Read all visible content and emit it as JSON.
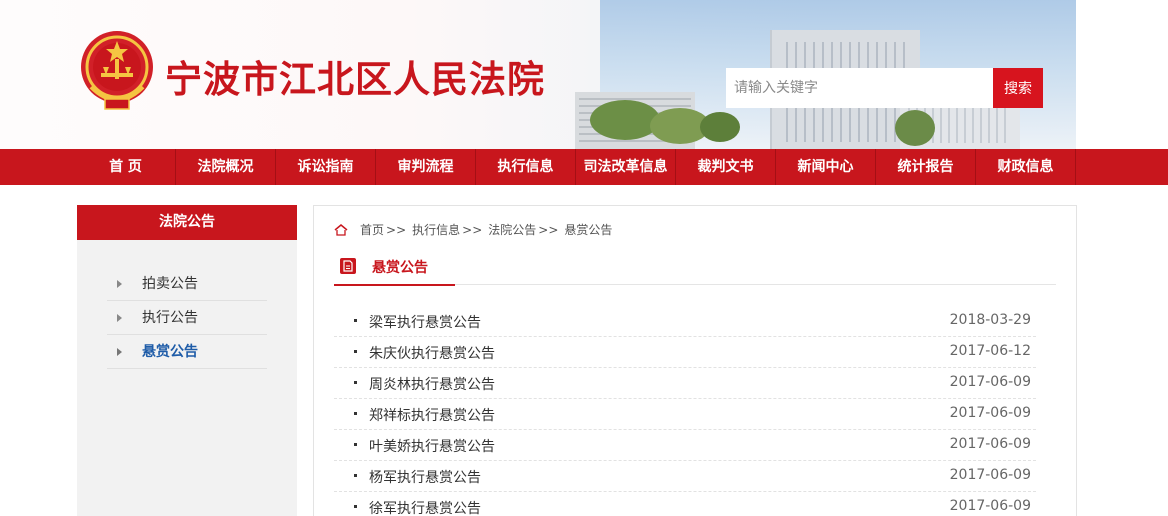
{
  "site": {
    "title": "宁波市江北区人民法院",
    "colors": {
      "brand_red": "#c8161d",
      "button_red": "#d7141e",
      "active_blue": "#1e5ca8"
    }
  },
  "search": {
    "placeholder": "请输入关键字",
    "button_label": "搜索"
  },
  "nav": {
    "items": [
      {
        "label": "首 页"
      },
      {
        "label": "法院概况"
      },
      {
        "label": "诉讼指南"
      },
      {
        "label": "审判流程"
      },
      {
        "label": "执行信息"
      },
      {
        "label": "司法改革信息"
      },
      {
        "label": "裁判文书"
      },
      {
        "label": "新闻中心"
      },
      {
        "label": "统计报告"
      },
      {
        "label": "财政信息"
      }
    ]
  },
  "sidebar": {
    "title": "法院公告",
    "items": [
      {
        "label": "拍卖公告"
      },
      {
        "label": "执行公告"
      },
      {
        "label": "悬赏公告",
        "active": true
      }
    ]
  },
  "breadcrumb": {
    "home_icon": "home-icon",
    "items": [
      "首页",
      "执行信息",
      "法院公告",
      "悬赏公告"
    ],
    "separator": ">>"
  },
  "section": {
    "icon": "document-icon",
    "title": "悬赏公告"
  },
  "list": [
    {
      "title": "梁军执行悬赏公告",
      "date": "2018-03-29"
    },
    {
      "title": "朱庆伙执行悬赏公告",
      "date": "2017-06-12"
    },
    {
      "title": "周炎林执行悬赏公告",
      "date": "2017-06-09"
    },
    {
      "title": "郑祥标执行悬赏公告",
      "date": "2017-06-09"
    },
    {
      "title": "叶美娇执行悬赏公告",
      "date": "2017-06-09"
    },
    {
      "title": "杨军执行悬赏公告",
      "date": "2017-06-09"
    },
    {
      "title": "徐军执行悬赏公告",
      "date": "2017-06-09"
    }
  ]
}
